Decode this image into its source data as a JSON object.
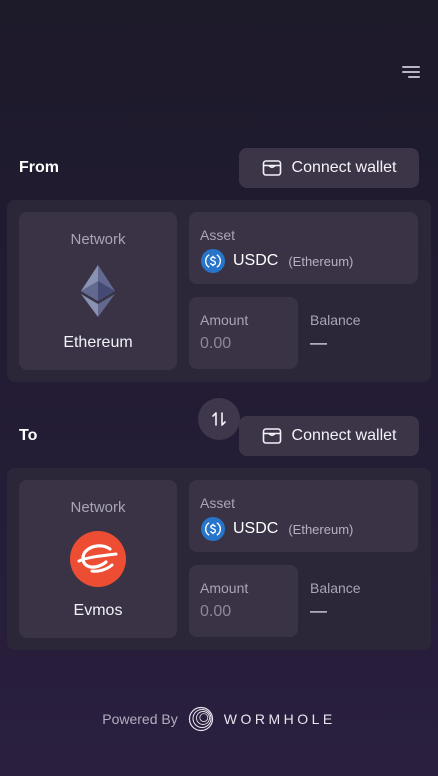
{
  "header": {
    "menu_icon": "menu-icon"
  },
  "from": {
    "label": "From",
    "connect_label": "Connect wallet",
    "network_label": "Network",
    "network_name": "Ethereum",
    "network_logo": "ethereum-logo",
    "asset_label": "Asset",
    "asset_symbol": "USDC",
    "asset_chain": "(Ethereum)",
    "amount_label": "Amount",
    "amount_placeholder": "0.00",
    "balance_label": "Balance",
    "balance_value": "—"
  },
  "swap": {
    "icon": "swap-vertical-icon"
  },
  "to": {
    "label": "To",
    "connect_label": "Connect wallet",
    "network_label": "Network",
    "network_name": "Evmos",
    "network_logo": "evmos-logo",
    "asset_label": "Asset",
    "asset_symbol": "USDC",
    "asset_chain": "(Ethereum)",
    "amount_label": "Amount",
    "amount_placeholder": "0.00",
    "balance_label": "Balance",
    "balance_value": "—"
  },
  "footer": {
    "powered_by": "Powered By",
    "brand": "WORMHOLE"
  },
  "colors": {
    "background": "#221c33",
    "card": "#3a3346",
    "panel": "#2c2639",
    "evmos": "#ed4e33",
    "usdc": "#2775ca"
  }
}
